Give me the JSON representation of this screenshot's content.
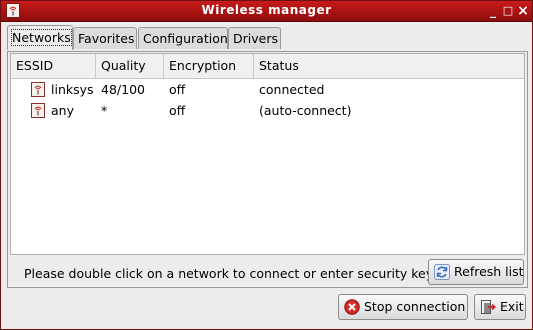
{
  "window": {
    "title": "Wireless manager",
    "minimize": "_",
    "maximize": "□",
    "close": "×"
  },
  "tabs": [
    {
      "label": "Networks",
      "active": true
    },
    {
      "label": "Favorites",
      "active": false
    },
    {
      "label": "Configuration",
      "active": false
    },
    {
      "label": "Drivers",
      "active": false
    }
  ],
  "table": {
    "columns": [
      "ESSID",
      "Quality",
      "Encryption",
      "Status"
    ],
    "rows": [
      {
        "essid": "linksys",
        "quality": "48/100",
        "encryption": "off",
        "status": "connected",
        "icon": "wifi-icon"
      },
      {
        "essid": "any",
        "quality": "*",
        "encryption": "off",
        "status": "(auto-connect)",
        "icon": "wifi-icon"
      }
    ]
  },
  "hint": "Please double click on a network to connect or enter security key",
  "buttons": {
    "refresh": {
      "label": "Refresh list",
      "icon": "refresh-icon"
    },
    "stop": {
      "label": "Stop connection",
      "icon": "stop-icon"
    },
    "exit": {
      "label": "Exit",
      "icon": "exit-icon"
    }
  },
  "colors": {
    "titlebar": "#b01414",
    "accent_red": "#cc2222",
    "refresh_blue": "#3a6ebf"
  }
}
